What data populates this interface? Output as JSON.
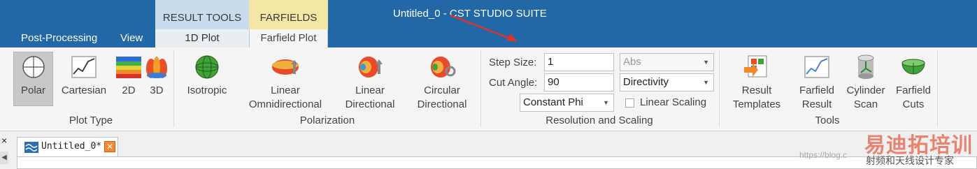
{
  "window": {
    "title": "Untitled_0 - CST STUDIO SUITE",
    "title_bar_color": "#2268a6"
  },
  "main_tabs": [
    "Post-Processing",
    "View"
  ],
  "context_groups": {
    "result_tools": {
      "title": "RESULT TOOLS",
      "tab": "1D Plot",
      "color": "#c9dcee"
    },
    "farfields": {
      "title": "FARFIELDS",
      "tab": "Farfield Plot",
      "color": "#f4e6a4"
    }
  },
  "plot_type": {
    "group_label": "Plot Type",
    "buttons": {
      "polar": "Polar",
      "cartesian": "Cartesian",
      "2d": "2D",
      "3d": "3D"
    },
    "selected": "Polar"
  },
  "polarization": {
    "group_label": "Polarization",
    "buttons": {
      "isotropic": "Isotropic",
      "linear_omni_1": "Linear",
      "linear_omni_2": "Omnidirectional",
      "linear_dir_1": "Linear",
      "linear_dir_2": "Directional",
      "circular_1": "Circular",
      "circular_2": "Directional"
    }
  },
  "resolution": {
    "group_label": "Resolution and Scaling",
    "step_size_label": "Step Size:",
    "step_size_value": "1",
    "cut_angle_label": "Cut Angle:",
    "cut_angle_value": "90",
    "mode_value": "Constant Phi",
    "abs_value": "Abs",
    "quantity_value": "Directivity",
    "linear_scaling_label": "Linear Scaling",
    "linear_scaling_checked": false
  },
  "tools": {
    "group_label": "Tools",
    "buttons": {
      "result_templates_1": "Result",
      "result_templates_2": "Templates",
      "farfield_result_1": "Farfield",
      "farfield_result_2": "Result",
      "cylinder_scan_1": "Cylinder",
      "cylinder_scan_2": "Scan",
      "farfield_cuts_1": "Farfield",
      "farfield_cuts_2": "Cuts"
    }
  },
  "document": {
    "tab_label": "Untitled_0*",
    "left_close": "×"
  },
  "watermark": {
    "main": "易迪拓培训",
    "url": "https://blog.c",
    "sub": "射频和天线设计专家"
  }
}
